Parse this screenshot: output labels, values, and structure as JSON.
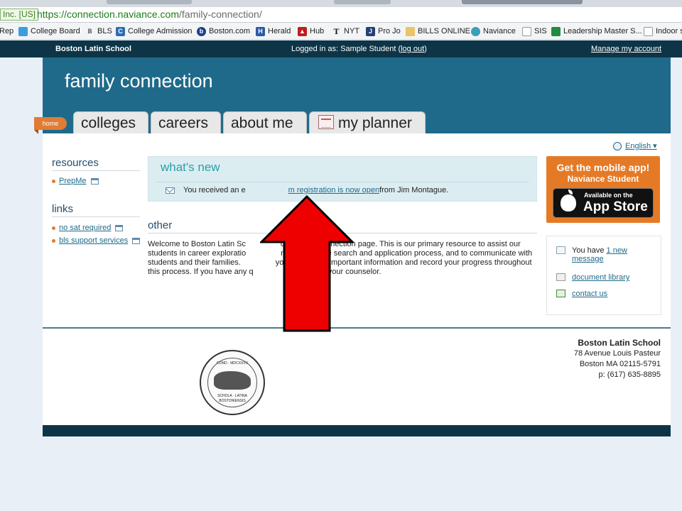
{
  "browser": {
    "ev_badge": "Inc. [US]",
    "url_host": "https://connection.naviance.com",
    "url_path": "/family-connection/",
    "bookmarks": [
      {
        "label": "Rep",
        "icon": "none"
      },
      {
        "label": "College Board",
        "icon": "college-board-icon"
      },
      {
        "label": "BLS",
        "icon": "bls-icon"
      },
      {
        "label": "College Admission",
        "icon": "college-admission-icon"
      },
      {
        "label": "Boston.com",
        "icon": "boston-com-icon"
      },
      {
        "label": "Herald",
        "icon": "herald-icon"
      },
      {
        "label": "Hub",
        "icon": "hub-icon"
      },
      {
        "label": "NYT",
        "icon": "nyt-icon"
      },
      {
        "label": "Pro Jo",
        "icon": "projo-icon"
      },
      {
        "label": "BILLS ONLINE",
        "icon": "folder-icon"
      },
      {
        "label": "Naviance",
        "icon": "naviance-icon"
      },
      {
        "label": "SIS",
        "icon": "page-icon"
      },
      {
        "label": "Leadership Master S...",
        "icon": "sheets-icon"
      },
      {
        "label": "Indoor s",
        "icon": "page-icon"
      }
    ]
  },
  "topbar": {
    "school": "Boston Latin School",
    "logged_in_prefix": "Logged in as: Sample Student (",
    "logout": "log out",
    "logged_in_suffix": ")",
    "manage": "Manage my account"
  },
  "header": {
    "brand": "family connection",
    "home": "home",
    "tabs": [
      "colleges",
      "careers",
      "about me",
      "my planner"
    ]
  },
  "language": "English ▾",
  "sidebar": {
    "resources_title": "resources",
    "resources": [
      "PrepMe"
    ],
    "links_title": "links",
    "links": [
      "no sat required",
      "bls support services"
    ]
  },
  "whats_new": {
    "title": "what's new",
    "msg_prefix": "You received an e",
    "msg_link": "m registration is now open",
    "msg_suffix": " from Jim Montague."
  },
  "other": {
    "title": "other",
    "text": "Welcome to Boston Latin Sc                ce Family Connection page. This is our primary resource to assist our students in career exploratio                ng, the college search and application process, and to communicate with students and their families.                you will update important information and record your progress throughout this process. If you have any q                please see your counselor."
  },
  "appstore": {
    "line1": "Get the mobile app!",
    "line2": "Naviance Student",
    "available": "Available on the",
    "store": "App Store"
  },
  "messages": {
    "have_prefix": "You have ",
    "new_count_link": "1 new",
    "message_word": "message",
    "document_library": "document library",
    "contact_us": "contact us"
  },
  "seal": {
    "top": "COND · MDCXXXV",
    "bottom1": "SCHOLA · LATINA",
    "bottom2": "BOSTONIENSIS"
  },
  "footer": {
    "name": "Boston Latin School",
    "street": "78 Avenue Louis Pasteur",
    "city": "Boston MA 02115-5791",
    "phone": "p: (617) 635-8895"
  },
  "colors": {
    "header": "#1f6a8a",
    "topbar": "#0d3547",
    "accent": "#e07c34",
    "arrow": "#ee0000"
  }
}
